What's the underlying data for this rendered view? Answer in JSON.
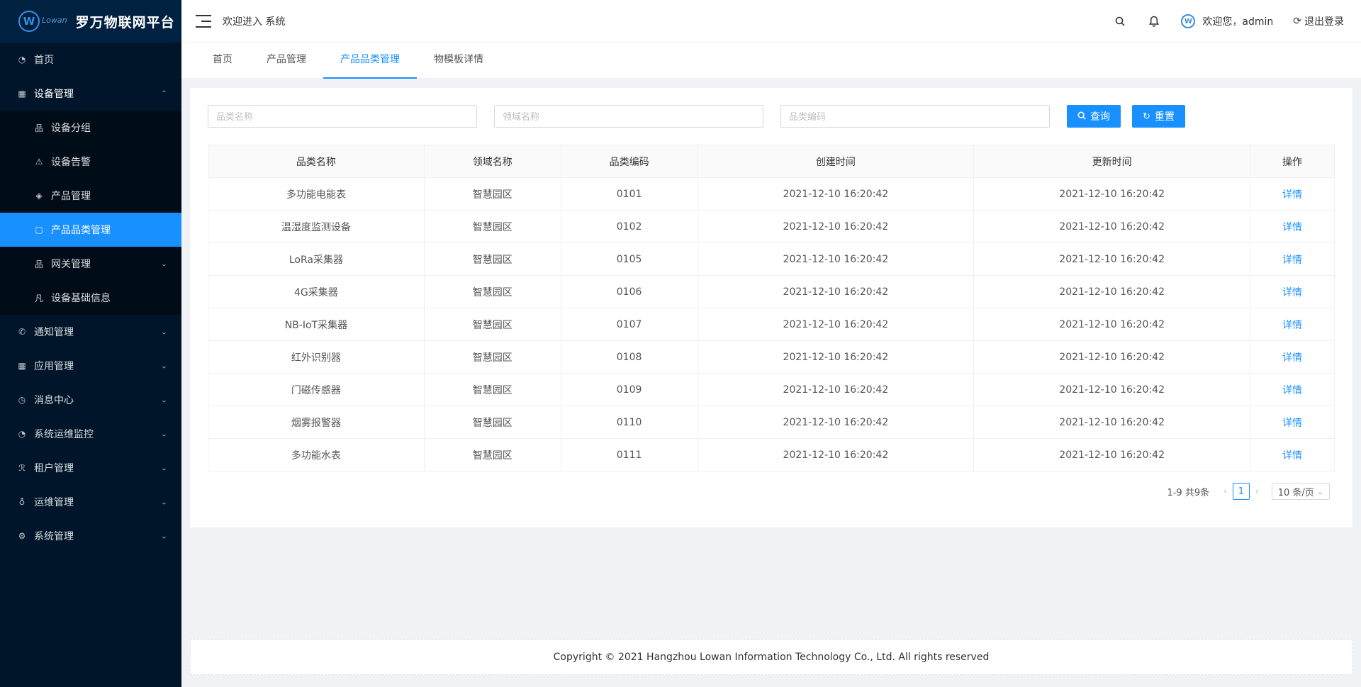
{
  "brand": {
    "mark": "W",
    "sub": "Lowan",
    "title": "罗万物联网平台"
  },
  "sidebar": {
    "items": [
      {
        "label": "首页",
        "icon": "dashboard-icon"
      },
      {
        "label": "设备管理",
        "icon": "devices-icon",
        "open": true,
        "children": [
          {
            "label": "设备分组",
            "icon": "group-icon"
          },
          {
            "label": "设备告警",
            "icon": "warning-icon"
          },
          {
            "label": "产品管理",
            "icon": "product-icon"
          },
          {
            "label": "产品品类管理",
            "icon": "lock-icon",
            "active": true
          },
          {
            "label": "网关管理",
            "icon": "gateway-icon"
          },
          {
            "label": "设备基础信息",
            "icon": "info-icon"
          }
        ]
      },
      {
        "label": "通知管理",
        "icon": "phone-icon"
      },
      {
        "label": "应用管理",
        "icon": "apps-icon"
      },
      {
        "label": "消息中心",
        "icon": "message-icon"
      },
      {
        "label": "系统运维监控",
        "icon": "monitor-icon"
      },
      {
        "label": "租户管理",
        "icon": "tenant-icon"
      },
      {
        "label": "运维管理",
        "icon": "ops-icon"
      },
      {
        "label": "系统管理",
        "icon": "settings-icon"
      }
    ]
  },
  "header": {
    "welcome": "欢迎进入 系统",
    "user_greeting": "欢迎您，admin",
    "logout": "退出登录"
  },
  "tabs": [
    {
      "label": "首页"
    },
    {
      "label": "产品管理"
    },
    {
      "label": "产品品类管理",
      "active": true
    },
    {
      "label": "物模板详情"
    }
  ],
  "filters": {
    "category_name_placeholder": "品类名称",
    "domain_name_placeholder": "领域名称",
    "category_code_placeholder": "品类编码",
    "search_label": "查询",
    "reset_label": "重置"
  },
  "table": {
    "columns": [
      "品类名称",
      "领域名称",
      "品类编码",
      "创建时间",
      "更新时间",
      "操作"
    ],
    "rows": [
      [
        "多功能电能表",
        "智慧园区",
        "0101",
        "2021-12-10 16:20:42",
        "2021-12-10 16:20:42",
        "详情"
      ],
      [
        "温湿度监测设备",
        "智慧园区",
        "0102",
        "2021-12-10 16:20:42",
        "2021-12-10 16:20:42",
        "详情"
      ],
      [
        "LoRa采集器",
        "智慧园区",
        "0105",
        "2021-12-10 16:20:42",
        "2021-12-10 16:20:42",
        "详情"
      ],
      [
        "4G采集器",
        "智慧园区",
        "0106",
        "2021-12-10 16:20:42",
        "2021-12-10 16:20:42",
        "详情"
      ],
      [
        "NB-IoT采集器",
        "智慧园区",
        "0107",
        "2021-12-10 16:20:42",
        "2021-12-10 16:20:42",
        "详情"
      ],
      [
        "红外识别器",
        "智慧园区",
        "0108",
        "2021-12-10 16:20:42",
        "2021-12-10 16:20:42",
        "详情"
      ],
      [
        "门磁传感器",
        "智慧园区",
        "0109",
        "2021-12-10 16:20:42",
        "2021-12-10 16:20:42",
        "详情"
      ],
      [
        "烟雾报警器",
        "智慧园区",
        "0110",
        "2021-12-10 16:20:42",
        "2021-12-10 16:20:42",
        "详情"
      ],
      [
        "多功能水表",
        "智慧园区",
        "0111",
        "2021-12-10 16:20:42",
        "2021-12-10 16:20:42",
        "详情"
      ]
    ]
  },
  "pagination": {
    "summary": "1-9 共9条",
    "current_page": "1",
    "page_size": "10 条/页"
  },
  "footer": {
    "copyright": "Copyright © 2021 Hangzhou Lowan Information Technology Co., Ltd. All rights reserved"
  },
  "colors": {
    "primary": "#1890ff",
    "sidebar_bg": "#001529",
    "sidebar_sub_bg": "#000c17"
  }
}
